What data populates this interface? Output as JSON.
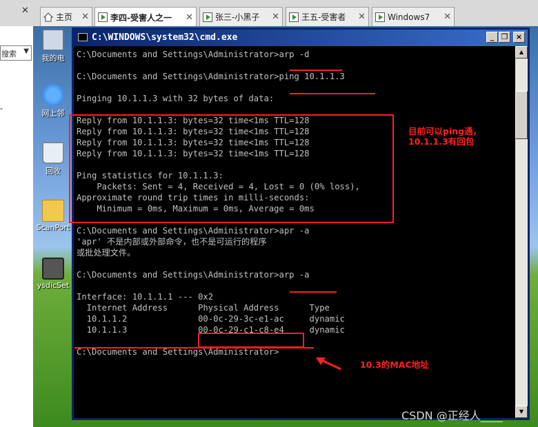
{
  "tabs": [
    {
      "label": "主页",
      "icon": "home-icon"
    },
    {
      "label": "李四-受害人之一",
      "icon": "vm-icon"
    },
    {
      "label": "张三-小黑子",
      "icon": "vm-icon"
    },
    {
      "label": "王五-受害者",
      "icon": "vm-icon"
    },
    {
      "label": "Windows7",
      "icon": "vm-icon"
    }
  ],
  "host_panel": {
    "search_label": "搜索",
    "dash": "-"
  },
  "desktop_icons": [
    {
      "label": "我的电",
      "icon": "my-computer-icon"
    },
    {
      "label": "网上邻",
      "icon": "network-places-icon"
    },
    {
      "label": "回收",
      "icon": "recycle-bin-icon"
    },
    {
      "label": "ScanPort",
      "icon": "folder-icon"
    },
    {
      "label": "ysdicSet",
      "icon": "device-icon"
    }
  ],
  "cmd_window": {
    "title": "C:\\WINDOWS\\system32\\cmd.exe",
    "minimize_label": "_",
    "maximize_label": "❐",
    "close_label": "×"
  },
  "console_lines": [
    "C:\\Documents and Settings\\Administrator>arp -d",
    "",
    "C:\\Documents and Settings\\Administrator>ping 10.1.1.3",
    "",
    "Pinging 10.1.1.3 with 32 bytes of data:",
    "",
    "Reply from 10.1.1.3: bytes=32 time<1ms TTL=128",
    "Reply from 10.1.1.3: bytes=32 time<1ms TTL=128",
    "Reply from 10.1.1.3: bytes=32 time<1ms TTL=128",
    "Reply from 10.1.1.3: bytes=32 time<1ms TTL=128",
    "",
    "Ping statistics for 10.1.1.3:",
    "    Packets: Sent = 4, Received = 4, Lost = 0 (0% loss),",
    "Approximate round trip times in milli-seconds:",
    "    Minimum = 0ms, Maximum = 0ms, Average = 0ms",
    "",
    "C:\\Documents and Settings\\Administrator>apr -a",
    "'apr' 不是内部或外部命令，也不是可运行的程序",
    "或批处理文件。",
    "",
    "C:\\Documents and Settings\\Administrator>arp -a",
    "",
    "Interface: 10.1.1.1 --- 0x2",
    "  Internet Address      Physical Address      Type",
    "  10.1.1.2              00-0c-29-3c-e1-ac     dynamic",
    "  10.1.1.3              00-0c-29-c1-c8-e4     dynamic",
    "",
    "C:\\Documents and Settings\\Administrator>"
  ],
  "annotations": {
    "ping_note": "目前可以ping通，\n10.1.1.3有回包",
    "mac_note": "10.3的MAC地址",
    "color": "#ff2020"
  },
  "watermark": "CSDN @正经人____"
}
